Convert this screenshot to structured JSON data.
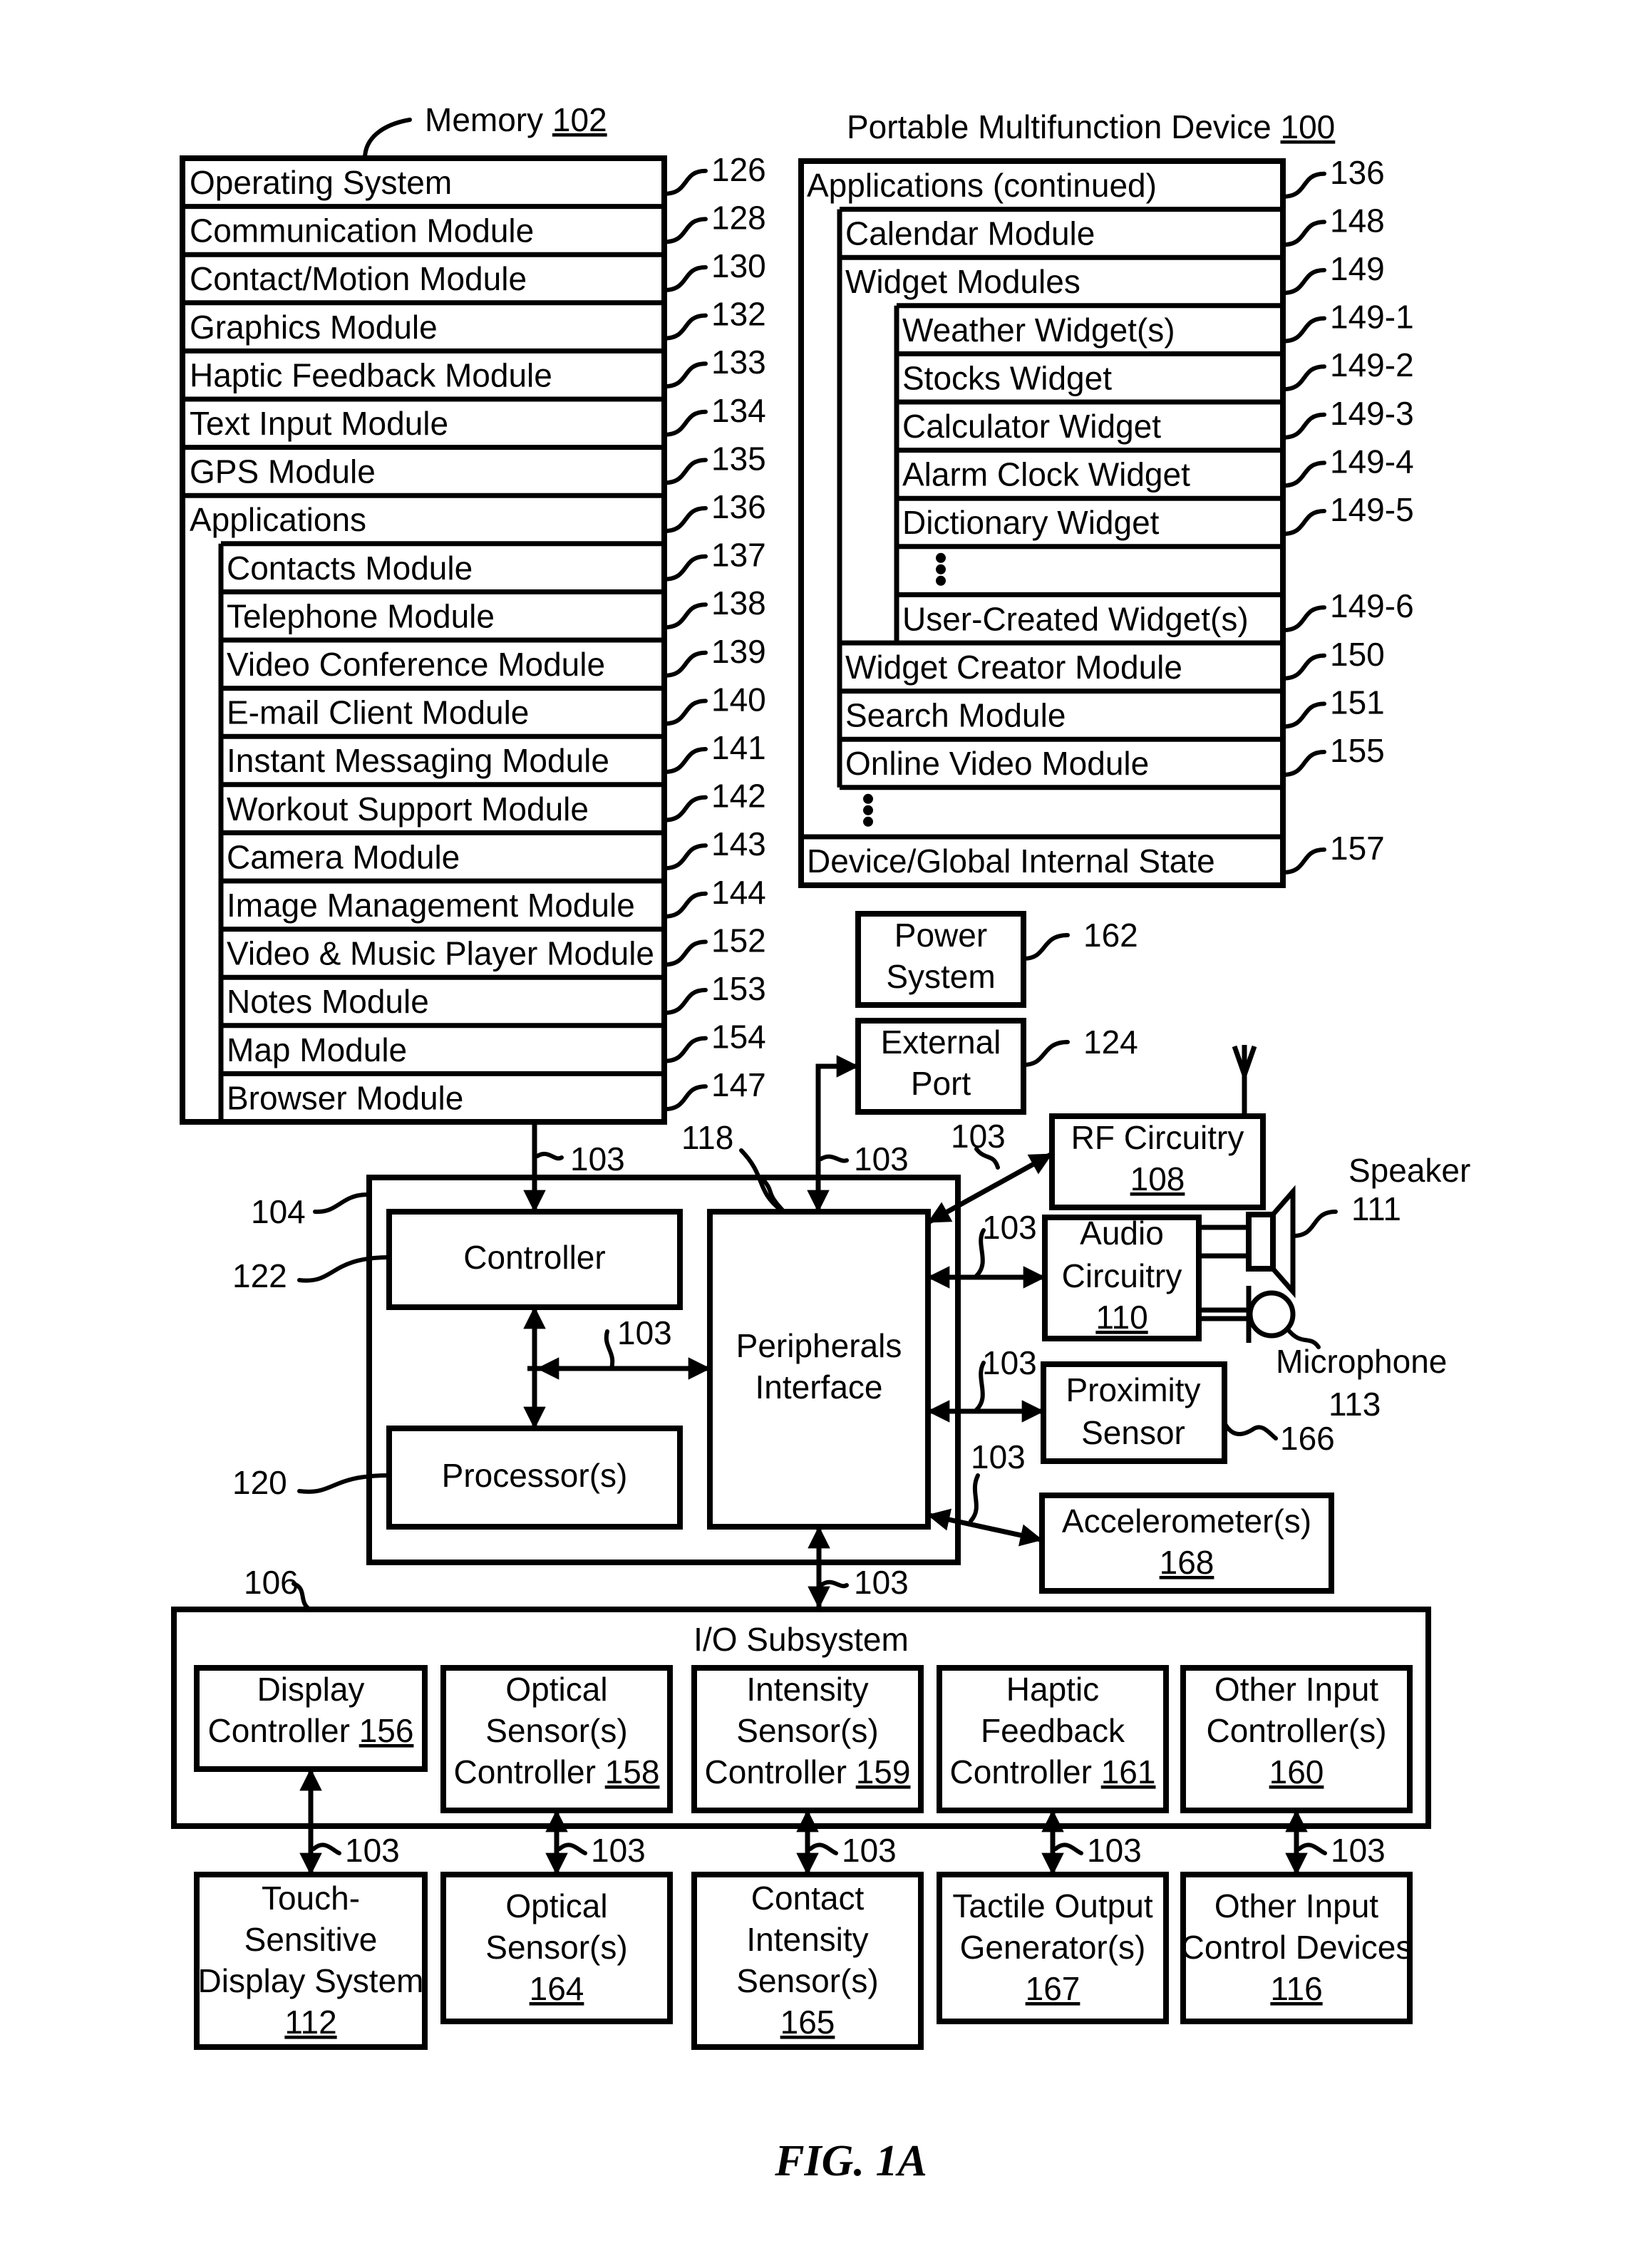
{
  "figure_caption": "FIG. 1A",
  "memory": {
    "title": "Memory",
    "ref": "102",
    "rows": [
      {
        "label": "Operating System",
        "ref": "126"
      },
      {
        "label": "Communication Module",
        "ref": "128"
      },
      {
        "label": "Contact/Motion Module",
        "ref": "130"
      },
      {
        "label": "Graphics Module",
        "ref": "132"
      },
      {
        "label": "Haptic Feedback Module",
        "ref": "133"
      },
      {
        "label": "Text Input Module",
        "ref": "134"
      },
      {
        "label": "GPS Module",
        "ref": "135"
      },
      {
        "label": "Applications",
        "ref": "136"
      }
    ],
    "applications": [
      {
        "label": "Contacts Module",
        "ref": "137"
      },
      {
        "label": "Telephone Module",
        "ref": "138"
      },
      {
        "label": "Video Conference Module",
        "ref": "139"
      },
      {
        "label": "E-mail Client Module",
        "ref": "140"
      },
      {
        "label": "Instant Messaging Module",
        "ref": "141"
      },
      {
        "label": "Workout Support Module",
        "ref": "142"
      },
      {
        "label": "Camera Module",
        "ref": "143"
      },
      {
        "label": "Image Management Module",
        "ref": "144"
      },
      {
        "label": "Video & Music Player Module",
        "ref": "152"
      },
      {
        "label": "Notes Module",
        "ref": "153"
      },
      {
        "label": "Map Module",
        "ref": "154"
      },
      {
        "label": "Browser Module",
        "ref": "147"
      }
    ]
  },
  "device": {
    "title": "Portable Multifunction Device",
    "ref": "100",
    "applications_continued": {
      "label": "Applications (continued)",
      "ref": "136"
    },
    "calendar": {
      "label": "Calendar Module",
      "ref": "148"
    },
    "widget_modules": {
      "label": "Widget Modules",
      "ref": "149"
    },
    "widgets": [
      {
        "label": "Weather Widget(s)",
        "ref": "149-1"
      },
      {
        "label": "Stocks Widget",
        "ref": "149-2"
      },
      {
        "label": "Calculator Widget",
        "ref": "149-3"
      },
      {
        "label": "Alarm Clock Widget",
        "ref": "149-4"
      },
      {
        "label": "Dictionary Widget",
        "ref": "149-5"
      },
      {
        "label": "User-Created Widget(s)",
        "ref": "149-6"
      }
    ],
    "after_widgets": [
      {
        "label": "Widget Creator Module",
        "ref": "150"
      },
      {
        "label": "Search Module",
        "ref": "151"
      },
      {
        "label": "Online Video Module",
        "ref": "155"
      }
    ],
    "state": {
      "label": "Device/Global Internal State",
      "ref": "157"
    }
  },
  "power": {
    "line1": "Power",
    "line2": "System",
    "ref": "162"
  },
  "external_port": {
    "line1": "External",
    "line2": "Port",
    "ref": "124"
  },
  "rf": {
    "line1": "RF Circuitry",
    "num": "108"
  },
  "audio": {
    "line1": "Audio",
    "line2": "Circuitry",
    "num": "110"
  },
  "speaker": {
    "label": "Speaker",
    "ref": "111"
  },
  "microphone": {
    "label": "Microphone",
    "ref": "113"
  },
  "proximity": {
    "line1": "Proximity",
    "line2": "Sensor",
    "ref": "166"
  },
  "accelerometer": {
    "line1": "Accelerometer(s)",
    "num": "168"
  },
  "core": {
    "ref_outer": "104",
    "controller": {
      "label": "Controller",
      "ref": "122"
    },
    "processor": {
      "label": "Processor(s)",
      "ref": "120"
    },
    "peripherals": {
      "line1": "Peripherals",
      "line2": "Interface",
      "ref": "118"
    }
  },
  "bus_ref": "103",
  "io": {
    "title": "I/O Subsystem",
    "ref": "106",
    "controllers": [
      {
        "lines": [
          "Display"
        ],
        "last": "Controller",
        "num": "156"
      },
      {
        "lines": [
          "Optical",
          "Sensor(s)"
        ],
        "last": "Controller",
        "num": "158"
      },
      {
        "lines": [
          "Intensity",
          "Sensor(s)"
        ],
        "last": "Controller",
        "num": "159"
      },
      {
        "lines": [
          "Haptic",
          "Feedback"
        ],
        "last": "Controller",
        "num": "161"
      },
      {
        "lines": [
          "Other Input",
          "Controller(s)"
        ],
        "last": "",
        "num": "160"
      }
    ],
    "devices": [
      {
        "lines": [
          "Touch-",
          "Sensitive",
          "Display System"
        ],
        "num": "112"
      },
      {
        "lines": [
          "Optical",
          "Sensor(s)"
        ],
        "num": "164"
      },
      {
        "lines": [
          "Contact",
          "Intensity",
          "Sensor(s)"
        ],
        "num": "165"
      },
      {
        "lines": [
          "Tactile Output",
          "Generator(s)"
        ],
        "num": "167"
      },
      {
        "lines": [
          "Other Input",
          "Control Devices"
        ],
        "num": "116"
      }
    ]
  }
}
